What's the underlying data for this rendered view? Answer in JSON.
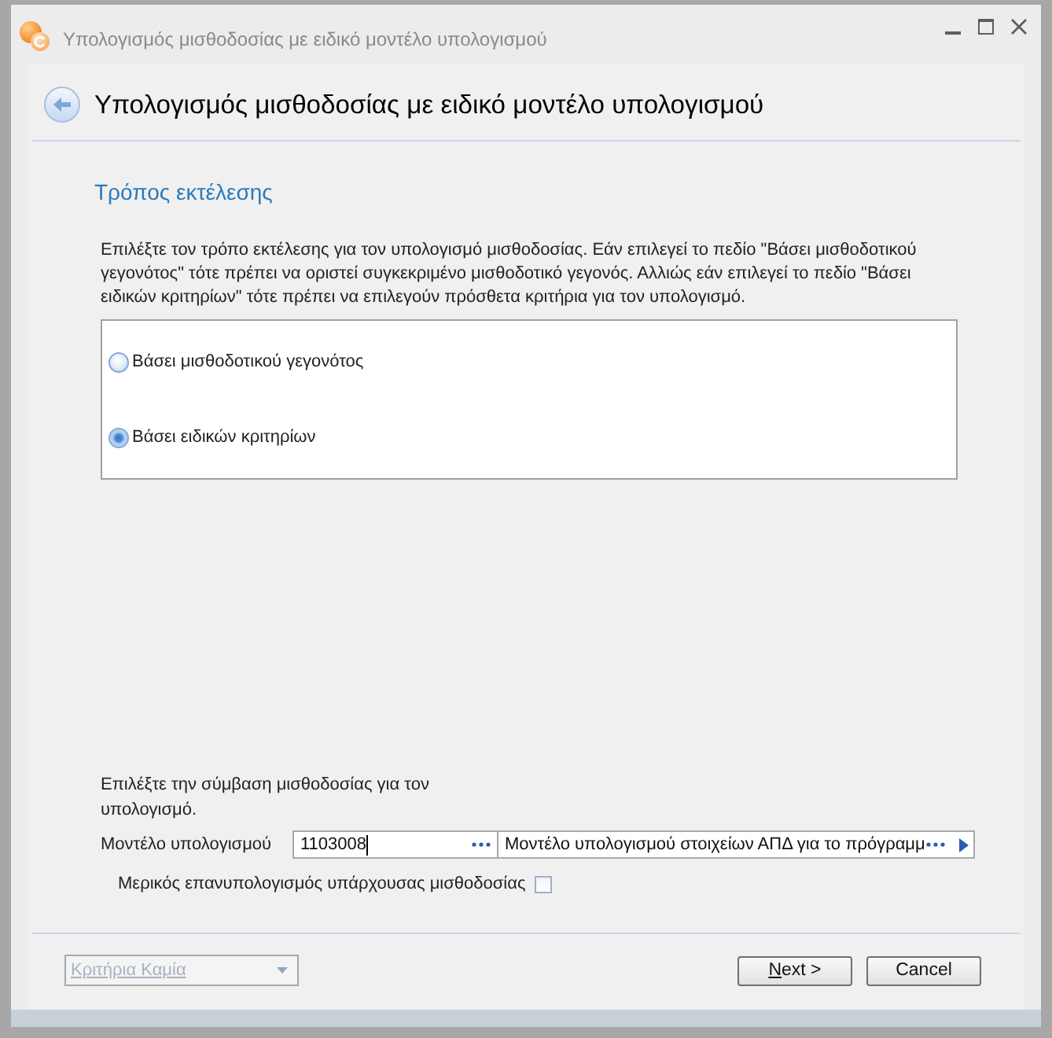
{
  "window": {
    "title": "Υπολογισμός μισθοδοσίας με ειδικό μοντέλο υπολογισμού"
  },
  "header": {
    "title": "Υπολογισμός μισθοδοσίας με ειδικό μοντέλο υπολογισμού"
  },
  "section": {
    "title": "Τρόπος εκτέλεσης",
    "description": "Επιλέξτε τον τρόπο εκτέλεσης για τον υπολογισμό μισθοδοσίας. Εάν επιλεγεί το πεδίο \"Βάσει μισθοδοτικού γεγονότος\" τότε πρέπει να οριστεί συγκεκριμένο μισθοδοτικό γεγονός. Αλλιώς εάν επιλεγεί το πεδίο \"Βάσει ειδικών κριτηρίων\" τότε πρέπει να επιλεγούν πρόσθετα κριτήρια για τον υπολογισμό."
  },
  "execution_modes": [
    {
      "label": "Βάσει μισθοδοτικού γεγονότος",
      "selected": false
    },
    {
      "label": "Βάσει ειδικών κριτηρίων",
      "selected": true
    }
  ],
  "contract": {
    "instruction": "Επιλέξτε την σύμβαση μισθοδοσίας για τον υπολογισμό.",
    "model_label": "Μοντέλο υπολογισμού",
    "code_field": {
      "value": "1103008",
      "focused": true
    },
    "name_field": {
      "value": "Μοντέλο υπολογισμού στοιχείων ΑΠΔ για το πρόγραμμ"
    }
  },
  "partial_recalc": {
    "label": "Μερικός επανυπολογισμός υπάρχουσας μισθοδοσίας",
    "checked": false
  },
  "footer": {
    "criteria_dropdown": {
      "value": "Κριτήρια Καμία",
      "disabled": true
    },
    "buttons": [
      {
        "label": "Next >",
        "first_letter_underlined": true
      },
      {
        "label": "Cancel",
        "first_letter_underlined": false
      }
    ]
  }
}
